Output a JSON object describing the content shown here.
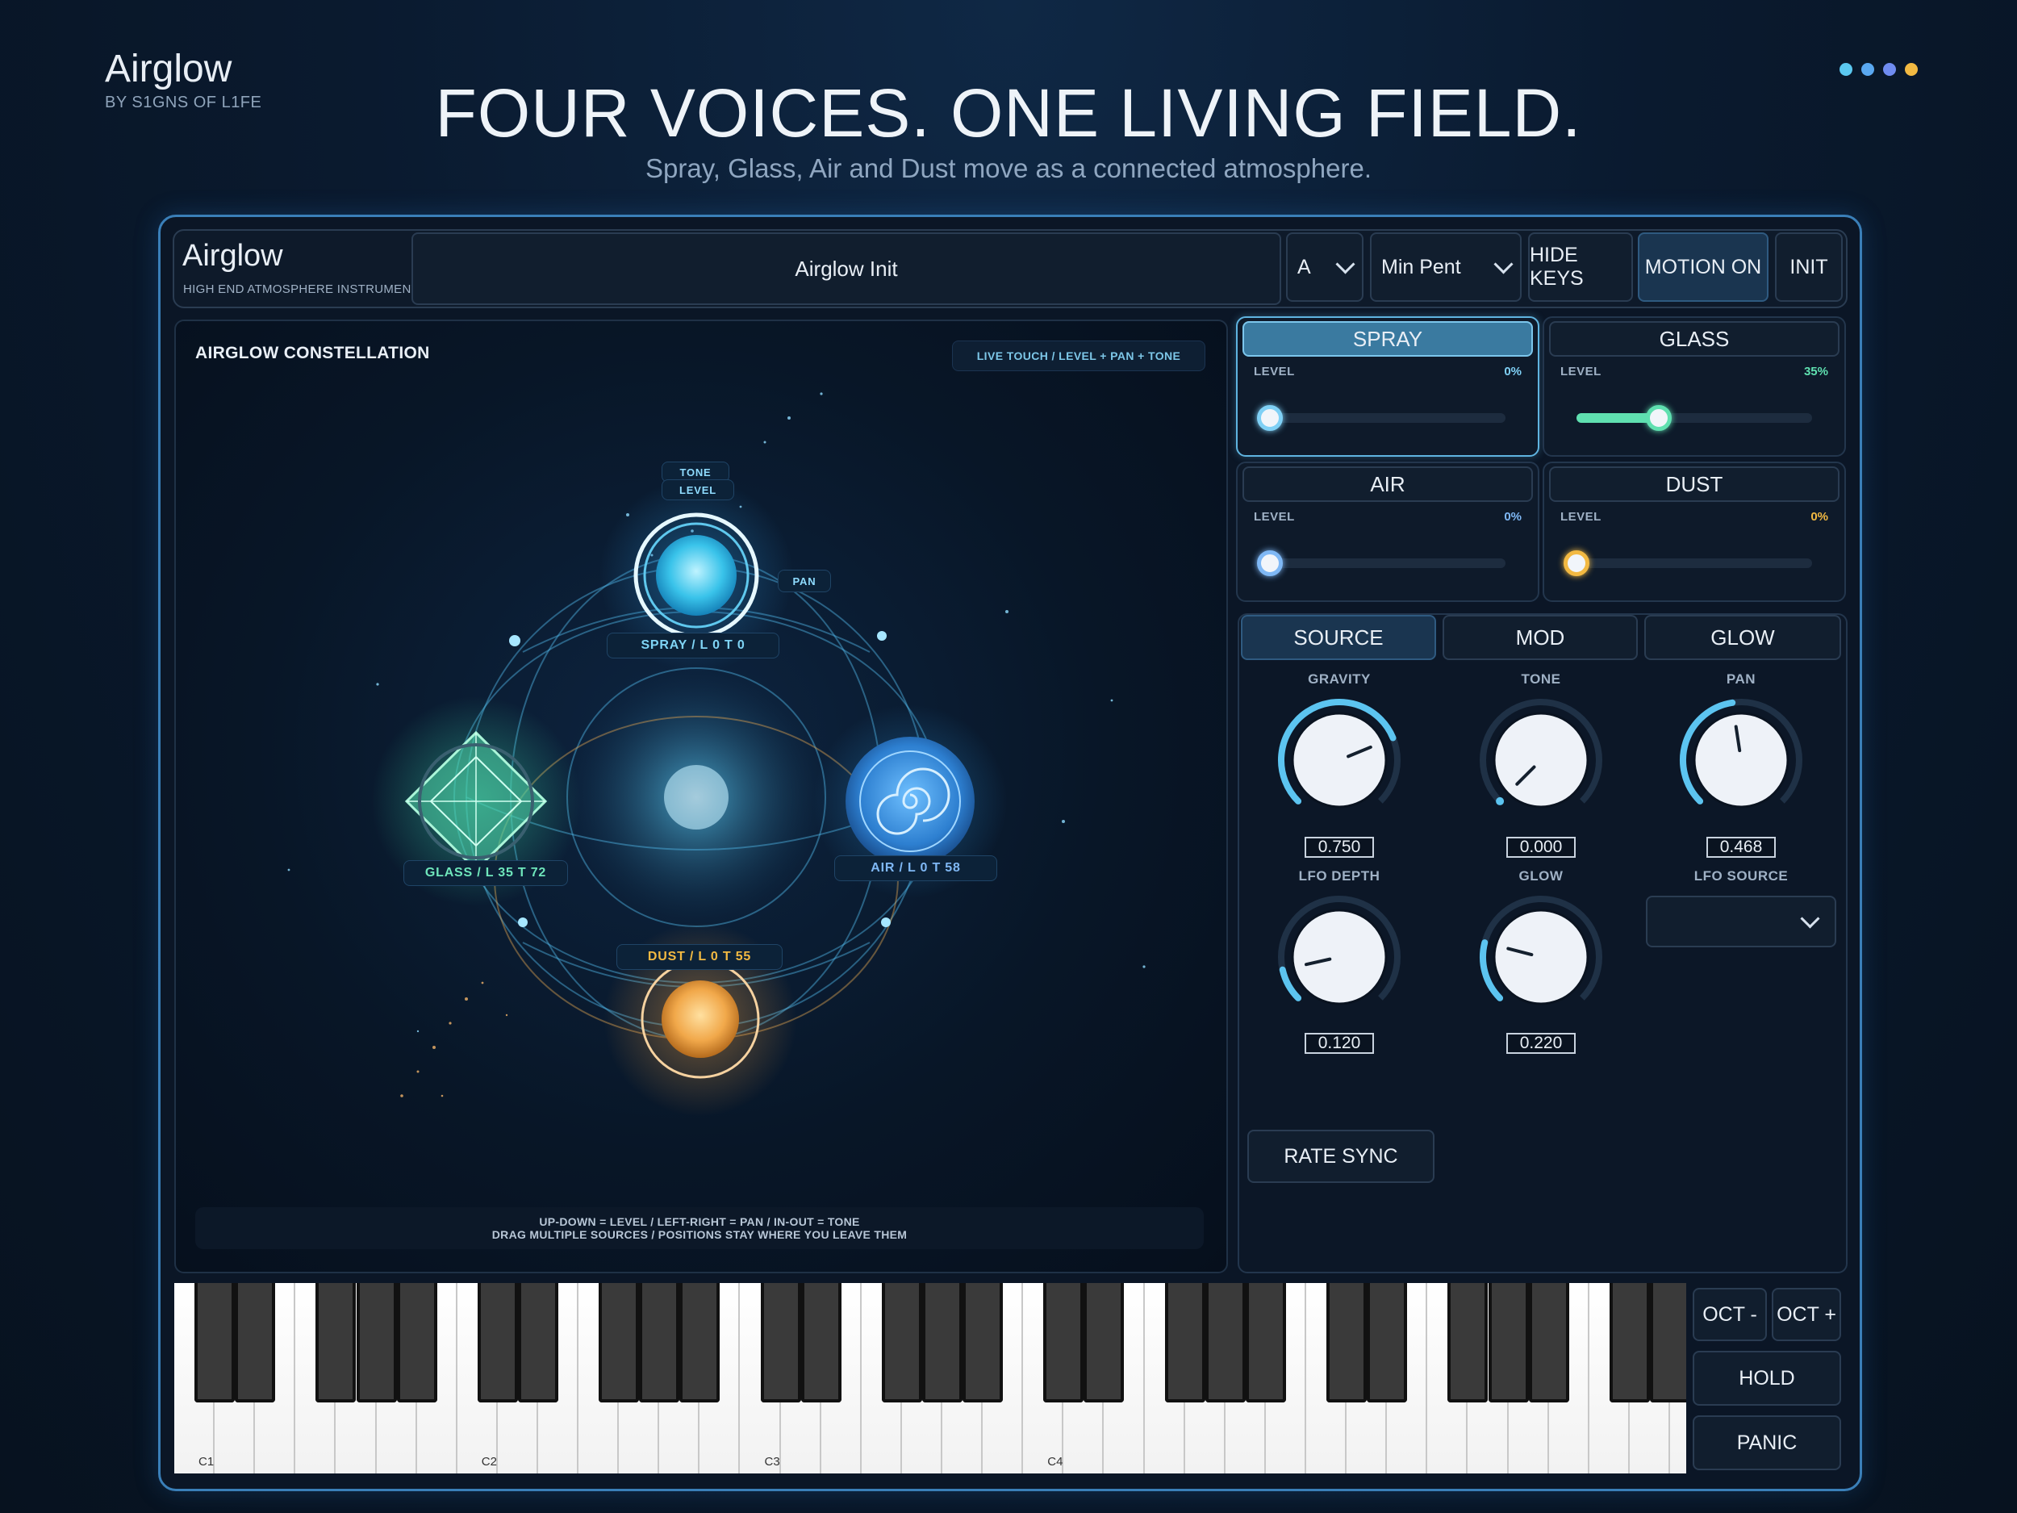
{
  "header": {
    "brand_name": "Airglow",
    "brand_by": "BY S1GNS OF L1FE",
    "headline": "FOUR VOICES. ONE LIVING FIELD.",
    "subline": "Spray, Glass, Air and Dust move as a connected atmosphere.",
    "dots": [
      "#5bc8f0",
      "#5aa8f0",
      "#6f8cf0",
      "#f2b942"
    ]
  },
  "topbar": {
    "title": "Airglow",
    "subtitle": "HIGH END ATMOSPHERE INSTRUMENT",
    "preset": "Airglow Init",
    "key": "A",
    "scale": "Min Pent",
    "hide_keys": "HIDE KEYS",
    "motion": "MOTION ON",
    "init": "INIT"
  },
  "field": {
    "title": "AIRGLOW CONSTELLATION",
    "hint": "LIVE TOUCH  /  LEVEL + PAN + TONE",
    "tag_tone": "TONE",
    "tag_level": "LEVEL",
    "tag_pan": "PAN",
    "spray_tag": "SPRAY  /  L 0  T 0",
    "glass_tag": "GLASS  /  L 35  T 72",
    "air_tag": "AIR  /  L 0  T 58",
    "dust_tag": "DUST  /  L 0  T 55",
    "foot_1": "UP-DOWN = LEVEL  /  LEFT-RIGHT = PAN  /  IN-OUT = TONE",
    "foot_2": "DRAG MULTIPLE SOURCES  /  POSITIONS STAY WHERE YOU LEAVE THEM"
  },
  "voices": [
    {
      "name": "SPRAY",
      "label": "LEVEL",
      "value_text": "0%",
      "level": 0,
      "color": "#7fd0f5"
    },
    {
      "name": "GLASS",
      "label": "LEVEL",
      "value_text": "35%",
      "level": 0.35,
      "color": "#5fe0b0"
    },
    {
      "name": "AIR",
      "label": "LEVEL",
      "value_text": "0%",
      "level": 0,
      "color": "#7fb8f5"
    },
    {
      "name": "DUST",
      "label": "LEVEL",
      "value_text": "0%",
      "level": 0,
      "color": "#f2b942"
    }
  ],
  "panel": {
    "tabs": [
      "SOURCE",
      "MOD",
      "GLOW"
    ],
    "knobs": [
      {
        "label": "GRAVITY",
        "value": "0.750"
      },
      {
        "label": "TONE",
        "value": "0.000"
      },
      {
        "label": "PAN",
        "value": "0.468"
      },
      {
        "label": "LFO DEPTH",
        "value": "0.120"
      },
      {
        "label": "GLOW",
        "value": "0.220"
      }
    ],
    "lfo_source_label": "LFO SOURCE",
    "rate_sync": "RATE SYNC"
  },
  "keyboard": {
    "octave_labels": [
      "C1",
      "C2",
      "C3",
      "C4"
    ],
    "oct_down": "OCT -",
    "oct_up": "OCT +",
    "hold": "HOLD",
    "panic": "PANIC"
  }
}
